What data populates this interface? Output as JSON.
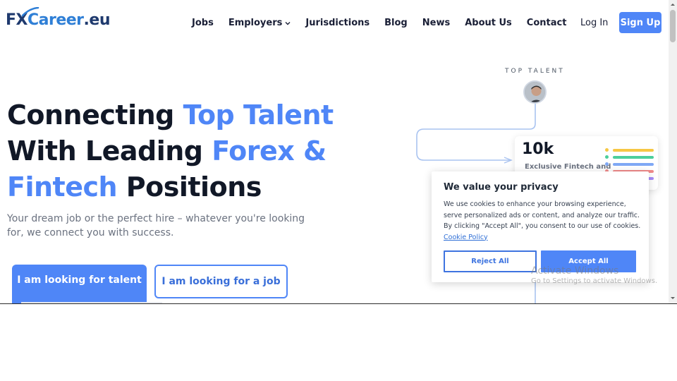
{
  "header": {
    "logo": {
      "fx": "FX",
      "career": "Career",
      "eu": ".eu"
    },
    "menu": [
      {
        "label": "Jobs",
        "dropdown": false
      },
      {
        "label": "Employers",
        "dropdown": true
      },
      {
        "label": "Jurisdictions",
        "dropdown": false
      },
      {
        "label": "Blog",
        "dropdown": false
      },
      {
        "label": "News",
        "dropdown": false
      },
      {
        "label": "About Us",
        "dropdown": false
      },
      {
        "label": "Contact",
        "dropdown": false
      }
    ],
    "login_label": "Log In",
    "signup_label": "Sign Up"
  },
  "hero": {
    "title_part1": "Connecting ",
    "title_accent1": "Top Talent",
    "title_part2": "With Leading ",
    "title_accent2": "Forex &",
    "title_accent3": "Fintech",
    "title_part3": " Positions",
    "subtitle": "Your dream job or the perfect hire – whatever you're looking for, we connect you with success.",
    "btn_talent": "I am looking for talent",
    "btn_job": "I am looking for a job"
  },
  "illustration": {
    "top_talent_label": "TOP TALENT",
    "stat_number": "10k",
    "stat_desc": "Exclusive Fintech and",
    "bar_colors": [
      "#f6c744",
      "#4ccf9b",
      "#7fa8f5",
      "#f08a8a",
      "#a78bfa"
    ]
  },
  "cookie": {
    "title": "We value your privacy",
    "text": "We use cookies to enhance your browsing experience, serve personalized ads or content, and analyze our traffic. By clicking \"Accept All\", you consent to our use of cookies. ",
    "link": "Cookie Policy",
    "reject_label": "Reject All",
    "accept_label": "Accept All"
  },
  "watermark": {
    "line1": "Activate Windows",
    "line2": "Go to Settings to activate Windows."
  },
  "colors": {
    "accent": "#4f86f7",
    "brand_dark": "#1f3a6e",
    "brand_light": "#2f7fd6"
  }
}
